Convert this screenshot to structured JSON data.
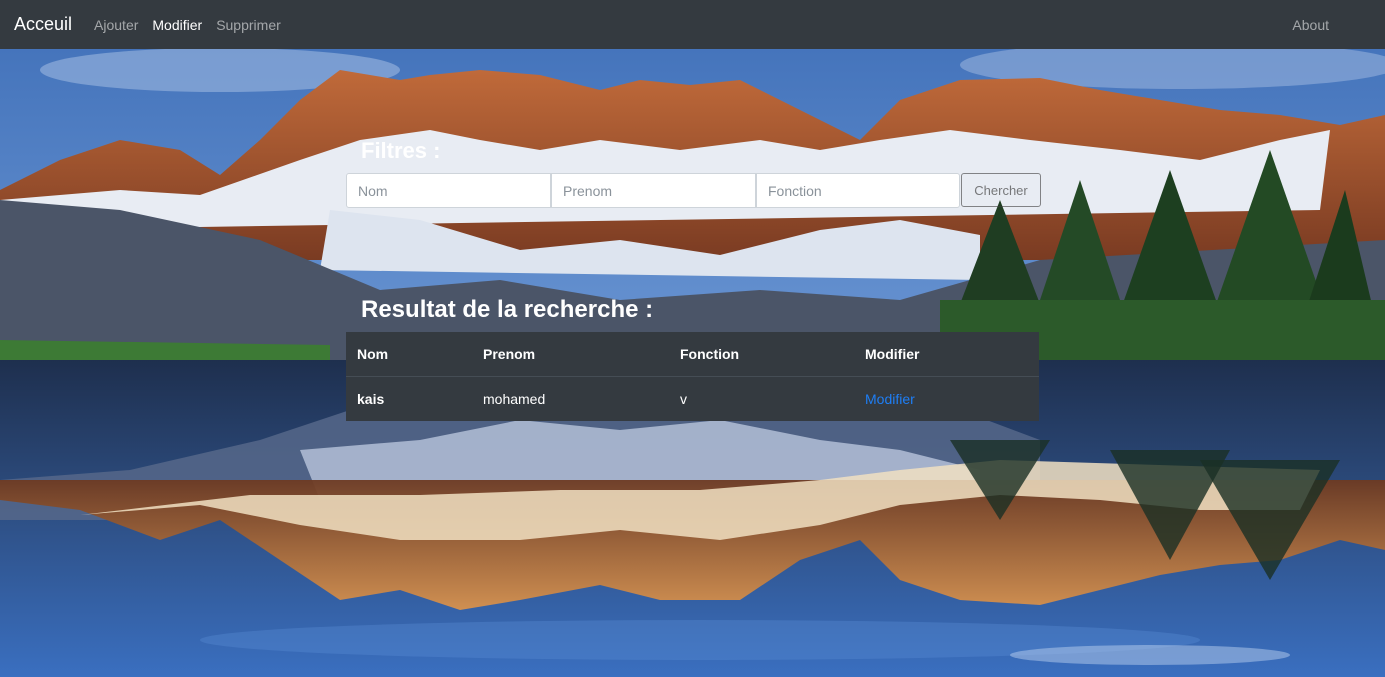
{
  "navbar": {
    "brand": "Acceuil",
    "links": [
      {
        "label": "Ajouter",
        "active": false
      },
      {
        "label": "Modifier",
        "active": true
      },
      {
        "label": "Supprimer",
        "active": false
      }
    ],
    "about": "About"
  },
  "filters": {
    "title": "Filtres :",
    "nom_placeholder": "Nom",
    "prenom_placeholder": "Prenom",
    "fonction_placeholder": "Fonction",
    "search_label": "Chercher"
  },
  "results": {
    "title": "Resultat de la recherche :",
    "headers": [
      "Nom",
      "Prenom",
      "Fonction",
      "Modifier"
    ],
    "rows": [
      {
        "nom": "kais",
        "prenom": "mohamed",
        "fonction": "v",
        "action": "Modifier"
      }
    ]
  },
  "colors": {
    "navbar_bg": "#343a40",
    "table_bg": "#343a40",
    "link": "#1e7ef5"
  }
}
